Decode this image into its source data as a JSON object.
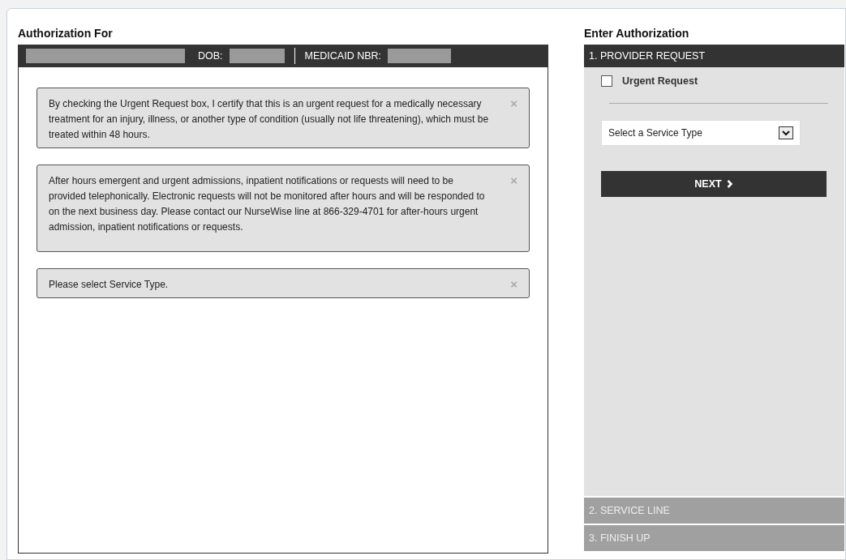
{
  "patient": {
    "title": "Authorization For",
    "dob_label": "DOB:",
    "medicaid_label": "MEDICAID NBR:"
  },
  "alerts": [
    {
      "text": "By checking the Urgent Request box, I certify that this is an urgent request for a medically necessary treatment for an injury, illness, or another type of condition (usually not life threatening), which must be treated within 48 hours.",
      "close": "×"
    },
    {
      "text": "After hours emergent and urgent admissions, inpatient notifications or requests will need to be provided telephonically. Electronic requests will not be monitored after hours and will be responded to on the next business day. Please contact our NurseWise line at 866-329-4701 for after-hours urgent admission, inpatient notifications or requests.",
      "close": "×"
    },
    {
      "text": "Please select Service Type.",
      "close": "×"
    }
  ],
  "authorization": {
    "title": "Enter Authorization",
    "steps": [
      {
        "label": "1. PROVIDER REQUEST",
        "selected": true
      },
      {
        "label": "2. SERVICE LINE",
        "selected": false
      },
      {
        "label": "3. FINISH UP",
        "selected": false
      }
    ],
    "urgent_request": {
      "label": "Urgent Request",
      "checked": false
    },
    "service_type": {
      "value": "Select a Service Type"
    },
    "next_button": {
      "label": "NEXT"
    }
  }
}
